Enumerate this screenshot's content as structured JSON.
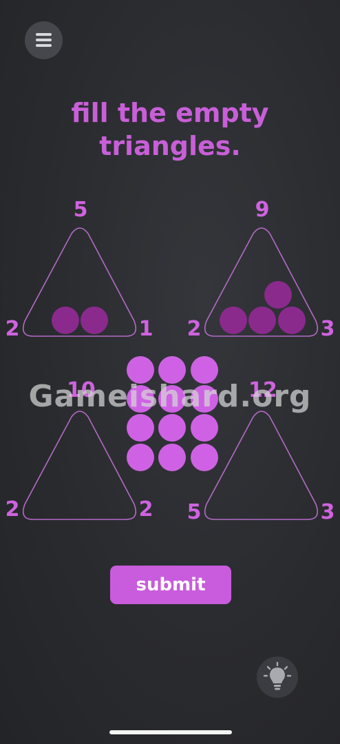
{
  "header": {
    "menu_icon": "hamburger-menu-icon"
  },
  "title": {
    "line1": "fill the empty",
    "line2": "triangles."
  },
  "triangles": [
    {
      "top": "5",
      "left": "2",
      "right": "1",
      "filled_balls": 2
    },
    {
      "top": "9",
      "left": "2",
      "right": "3",
      "filled_balls": 4
    },
    {
      "top": "10",
      "left": "2",
      "right": "2",
      "filled_balls": 0
    },
    {
      "top": "12",
      "left": "5",
      "right": "3",
      "filled_balls": 0
    }
  ],
  "ball_pool": {
    "count": 12
  },
  "watermark": "Gameishard.org",
  "submit_label": "submit",
  "hint": {
    "icon": "lightbulb-icon"
  },
  "colors": {
    "accent": "#c85fd8",
    "ball_pool": "#cf62e4",
    "ball_filled": "#8a2a8d",
    "triangle_outline": "#b46bc7",
    "background": "#2b2c30"
  }
}
